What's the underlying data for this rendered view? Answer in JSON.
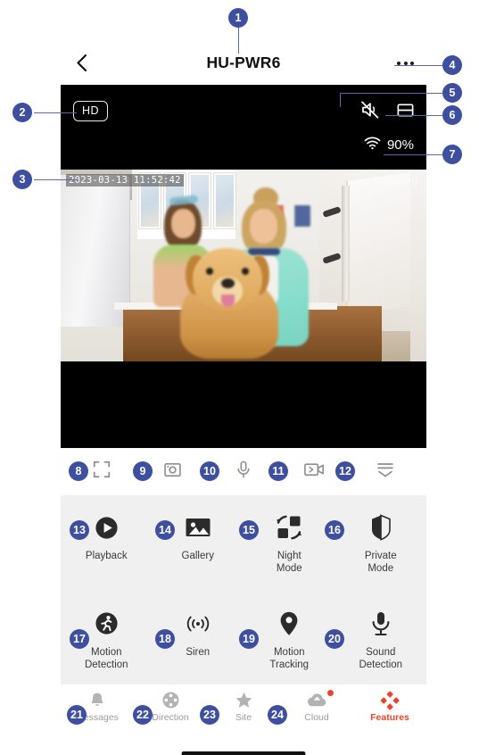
{
  "header": {
    "title": "HU-PWR6",
    "back_icon": "chevron-left-icon",
    "more_icon": "more-options-icon"
  },
  "video": {
    "quality_badge": "HD",
    "mute_icon": "speaker-muted-icon",
    "layout_icon": "split-screen-icon",
    "wifi_icon": "wifi-icon",
    "signal": "90%",
    "timestamp": "2023-03-13 11:52:42",
    "watermark": "hugolog"
  },
  "controls": [
    {
      "name": "fullscreen-button",
      "icon": "fullscreen-icon"
    },
    {
      "name": "snapshot-button",
      "icon": "camera-snapshot-icon"
    },
    {
      "name": "talk-button",
      "icon": "microphone-icon"
    },
    {
      "name": "record-button",
      "icon": "video-record-icon"
    },
    {
      "name": "collapse-button",
      "icon": "collapse-chevron-icon"
    }
  ],
  "features": {
    "row1": [
      {
        "label": "Playback",
        "icon": "play-circle-icon"
      },
      {
        "label": "Gallery",
        "icon": "image-icon"
      },
      {
        "label": "Night\nMode",
        "label_line1": "Night",
        "label_line2": "Mode",
        "icon": "night-mode-swap-icon"
      },
      {
        "label": "Private\nMode",
        "label_line1": "Private",
        "label_line2": "Mode",
        "icon": "private-mode-shield-icon"
      }
    ],
    "row2": [
      {
        "label_line1": "Motion",
        "label_line2": "Detection",
        "icon": "motion-detection-walk-icon"
      },
      {
        "label_line1": "Siren",
        "label_line2": "",
        "icon": "siren-waves-icon"
      },
      {
        "label_line1": "Motion",
        "label_line2": "Tracking",
        "icon": "motion-tracking-pin-icon"
      },
      {
        "label_line1": "Sound",
        "label_line2": "Detection",
        "icon": "sound-detection-mic-icon"
      }
    ]
  },
  "tabs": [
    {
      "label": "Messages",
      "icon": "bell-icon",
      "active": false,
      "badge": false
    },
    {
      "label": "Direction",
      "icon": "dpad-icon",
      "active": false,
      "badge": false
    },
    {
      "label": "Site",
      "icon": "star-icon",
      "active": false,
      "badge": false
    },
    {
      "label": "Cloud",
      "icon": "cloud-icon",
      "active": false,
      "badge": true
    },
    {
      "label": "Features",
      "icon": "features-diamond-icon",
      "active": true,
      "badge": false
    }
  ],
  "annotations": {
    "numbers": [
      "1",
      "2",
      "3",
      "4",
      "5",
      "6",
      "7",
      "8",
      "9",
      "10",
      "11",
      "12",
      "13",
      "14",
      "15",
      "16",
      "17",
      "18",
      "19",
      "20",
      "21",
      "22",
      "23",
      "24"
    ]
  },
  "colors": {
    "badge": "#3f4fa0",
    "accent": "#e8452f",
    "panel": "#f0f0f0"
  }
}
